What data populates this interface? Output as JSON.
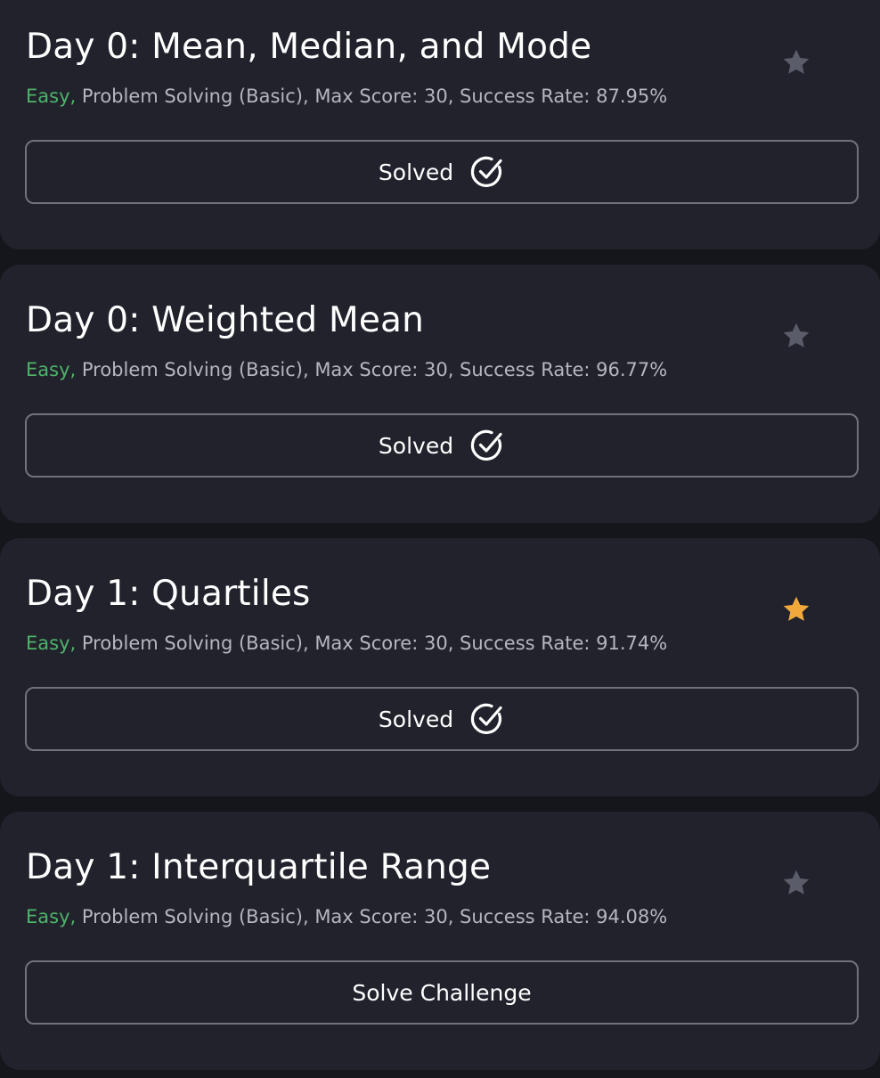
{
  "colors": {
    "page_background": "#15161b",
    "card_background": "#21222c",
    "difficulty_easy": "#4fb36a",
    "meta_text": "#b5b7c0",
    "star_inactive": "#5a5d69",
    "star_active": "#f2a93b",
    "button_border": "#70727c"
  },
  "challenges": [
    {
      "title": "Day 0: Mean, Median, and Mode",
      "difficulty": "Easy,",
      "details": " Problem Solving (Basic), Max Score: 30, Success Rate: 87.95%",
      "starred": false,
      "star_icon": "star-icon",
      "button_label": "Solved",
      "button_icon": "check-circle-icon"
    },
    {
      "title": "Day 0: Weighted Mean",
      "difficulty": "Easy,",
      "details": " Problem Solving (Basic), Max Score: 30, Success Rate: 96.77%",
      "starred": false,
      "star_icon": "star-icon",
      "button_label": "Solved",
      "button_icon": "check-circle-icon"
    },
    {
      "title": "Day 1: Quartiles",
      "difficulty": "Easy,",
      "details": " Problem Solving (Basic), Max Score: 30, Success Rate: 91.74%",
      "starred": true,
      "star_icon": "star-icon",
      "button_label": "Solved",
      "button_icon": "check-circle-icon"
    },
    {
      "title": "Day 1: Interquartile Range",
      "difficulty": "Easy,",
      "details": " Problem Solving (Basic), Max Score: 30, Success Rate: 94.08%",
      "starred": false,
      "star_icon": "star-icon",
      "button_label": "Solve Challenge",
      "button_icon": ""
    }
  ]
}
